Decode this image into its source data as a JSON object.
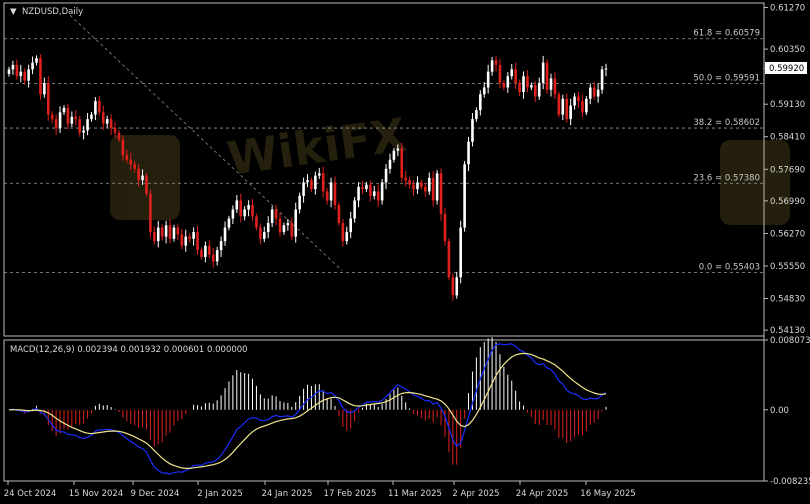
{
  "chart_data": [
    {
      "type": "candlestick",
      "title": "NZDUSD,Daily",
      "y_ticks": [
        "0.61270",
        "0.60350",
        "0.59920",
        "0.59130",
        "0.58410",
        "0.57690",
        "0.56990",
        "0.56270",
        "0.55550",
        "0.54830",
        "0.54130"
      ],
      "ylim": [
        0.54,
        0.6137
      ],
      "current_price": 0.5992,
      "x_ticks": [
        "24 Oct 2024",
        "15 Nov 2024",
        "9 Dec 2024",
        "2 Jan 2025",
        "24 Jan 2025",
        "17 Feb 2025",
        "11 Mar 2025",
        "2 Apr 2025",
        "24 Apr 2025",
        "16 May 2025"
      ],
      "fibonacci": [
        {
          "label": "61.8 = 0.60579",
          "value": 0.60579
        },
        {
          "label": "50.0 = 0.59591",
          "value": 0.59591
        },
        {
          "label": "38.2 = 0.58602",
          "value": 0.58602
        },
        {
          "label": "23.6 = 0.57380",
          "value": 0.5738
        },
        {
          "label": "0.0 = 0.55403",
          "value": 0.55403
        }
      ],
      "trendline": {
        "from": {
          "date": "Oct 2024",
          "value": 0.611
        },
        "to": {
          "date": "Feb 2025",
          "value": 0.5545
        }
      },
      "closes": [
        0.599,
        0.6,
        0.5975,
        0.5985,
        0.5965,
        0.599,
        0.6005,
        0.6015,
        0.5935,
        0.596,
        0.589,
        0.588,
        0.586,
        0.5895,
        0.5905,
        0.587,
        0.5885,
        0.588,
        0.585,
        0.5855,
        0.588,
        0.589,
        0.592,
        0.5895,
        0.587,
        0.588,
        0.586,
        0.585,
        0.5835,
        0.58,
        0.579,
        0.578,
        0.577,
        0.5745,
        0.5755,
        0.5715,
        0.563,
        0.561,
        0.564,
        0.562,
        0.5645,
        0.5615,
        0.564,
        0.5625,
        0.56,
        0.562,
        0.5615,
        0.563,
        0.559,
        0.5575,
        0.56,
        0.558,
        0.5565,
        0.559,
        0.561,
        0.564,
        0.566,
        0.568,
        0.57,
        0.5665,
        0.568,
        0.569,
        0.5665,
        0.564,
        0.5615,
        0.563,
        0.565,
        0.568,
        0.566,
        0.563,
        0.5645,
        0.565,
        0.562,
        0.568,
        0.571,
        0.574,
        0.5745,
        0.5725,
        0.5755,
        0.576,
        0.572,
        0.57,
        0.574,
        0.569,
        0.565,
        0.561,
        0.563,
        0.566,
        0.57,
        0.573,
        0.5725,
        0.5735,
        0.571,
        0.572,
        0.57,
        0.574,
        0.577,
        0.579,
        0.581,
        0.5815,
        0.575,
        0.5745,
        0.5735,
        0.5725,
        0.574,
        0.573,
        0.572,
        0.575,
        0.57,
        0.576,
        0.567,
        0.561,
        0.553,
        0.549,
        0.553,
        0.564,
        0.578,
        0.583,
        0.588,
        0.59,
        0.5935,
        0.595,
        0.5985,
        0.601,
        0.6,
        0.596,
        0.595,
        0.5975,
        0.599,
        0.596,
        0.594,
        0.5975,
        0.595,
        0.5955,
        0.593,
        0.596,
        0.6005,
        0.5945,
        0.597,
        0.5935,
        0.589,
        0.5925,
        0.588,
        0.591,
        0.593,
        0.592,
        0.5895,
        0.5925,
        0.595,
        0.593,
        0.5945,
        0.599,
        0.5992
      ]
    },
    {
      "type": "macd",
      "title": "MACD(12,26,9) 0.002394 0.001932 0.000601 0.000000",
      "y_ticks": [
        "0.008073",
        "0.00",
        "-0.008235"
      ],
      "ylim": [
        -0.008235,
        0.008073
      ]
    }
  ]
}
